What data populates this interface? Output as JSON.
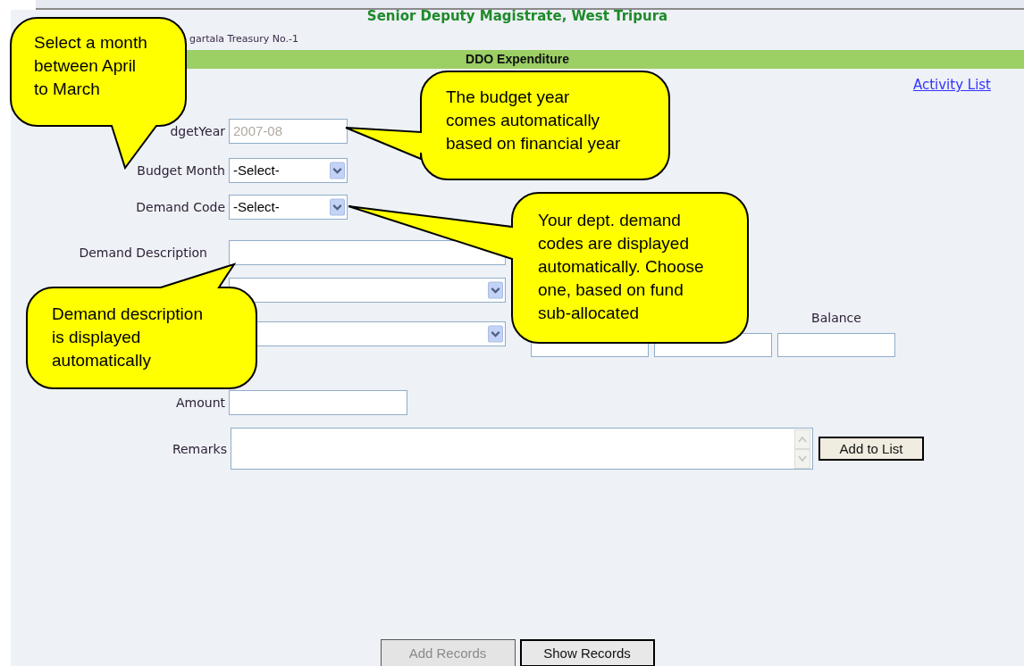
{
  "header": {
    "title": "Senior Deputy Magistrate, West Tripura",
    "subtitle": "gartala Treasury No.-1"
  },
  "section_title": "DDO Expenditure",
  "activity_link": "Activity List",
  "form": {
    "budget_year": {
      "label": "dgetYear",
      "value": "2007-08",
      "disabled": true
    },
    "budget_month": {
      "label": "Budget Month",
      "value": "-Select-"
    },
    "demand_code": {
      "label": "Demand Code",
      "value": "-Select-"
    },
    "demand_description": {
      "label": "Demand Description"
    },
    "balance_label": "Balance",
    "amount": {
      "label": "Amount"
    },
    "remarks": {
      "label": "Remarks"
    }
  },
  "buttons": [
    {
      "label": "Add to List",
      "disabled": false
    },
    {
      "label": "Add Records",
      "disabled": true
    },
    {
      "label": "Show Records",
      "disabled": false
    }
  ],
  "callouts": [
    {
      "text": "Select a month\nbetween April\nto March"
    },
    {
      "text": "The budget year\ncomes automatically\nbased on financial year"
    },
    {
      "text": "Your dept. demand\ncodes are displayed\nautomatically. Choose\none, based on fund\nsub-allocated"
    },
    {
      "text": "Demand description\nis displayed\nautomatically"
    }
  ]
}
